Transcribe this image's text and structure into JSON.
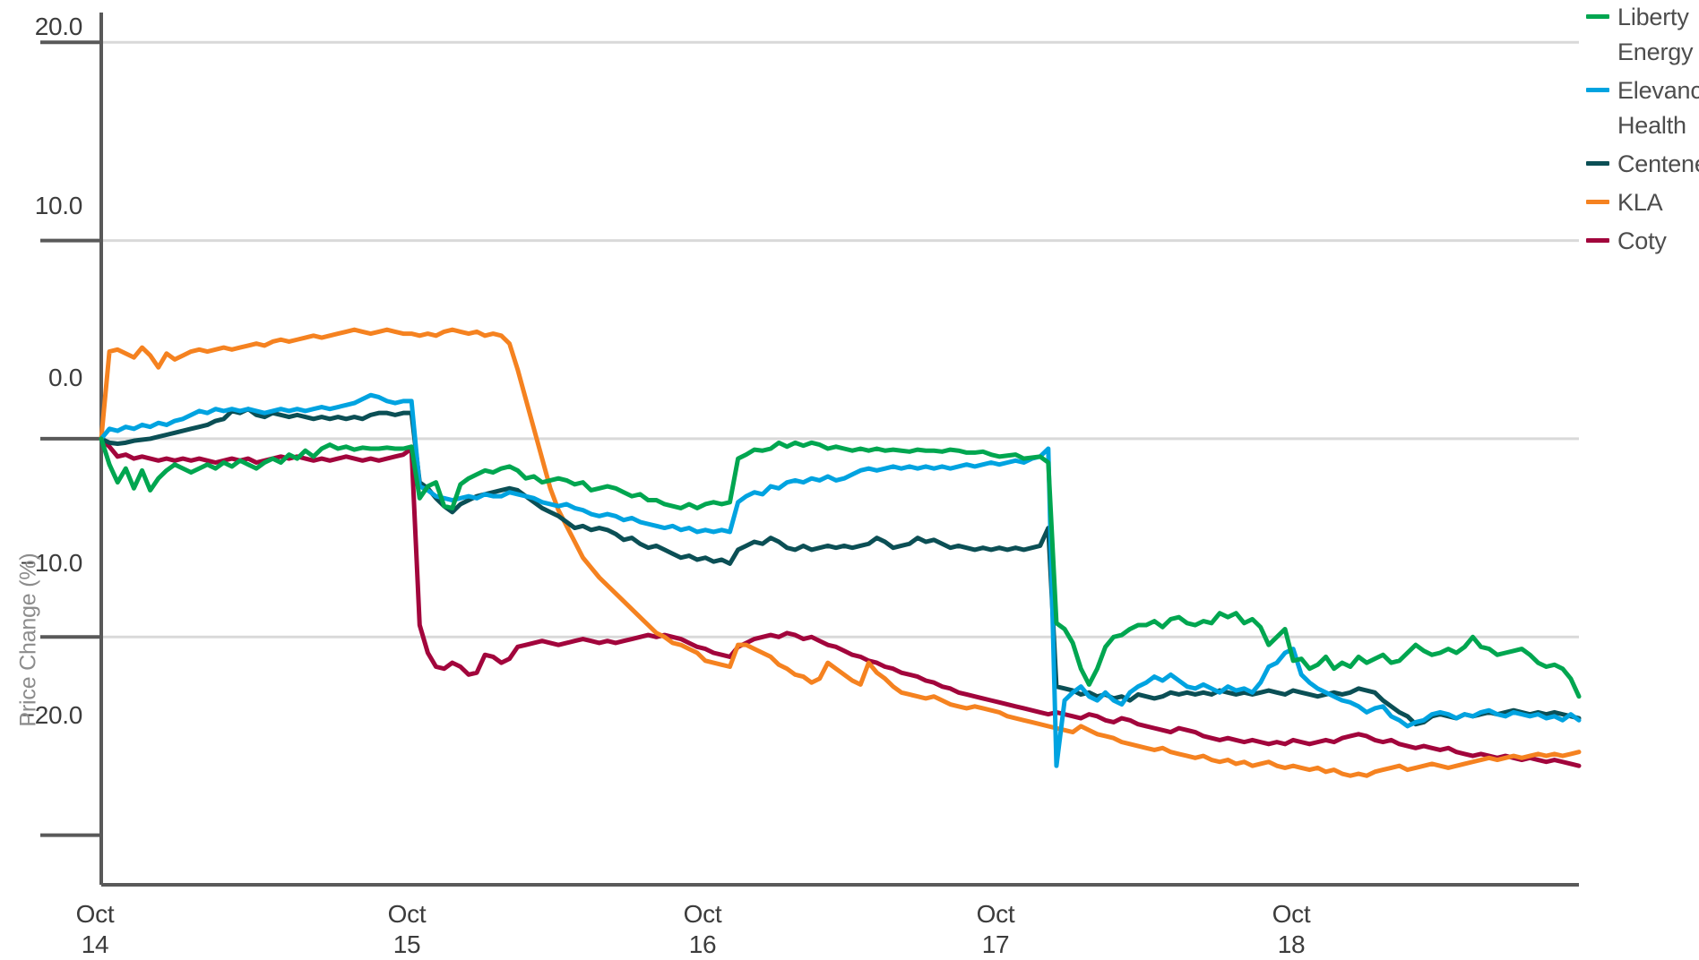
{
  "axes": {
    "ylabel": "Price Change (%)",
    "xlabel": "",
    "y_ticks": [
      "20.0",
      "10.0",
      "0.0",
      "−10.0",
      "−20.0"
    ],
    "x_ticks": [
      {
        "month": "Oct",
        "day": "14"
      },
      {
        "month": "Oct",
        "day": "15"
      },
      {
        "month": "Oct",
        "day": "16"
      },
      {
        "month": "Oct",
        "day": "17"
      },
      {
        "month": "Oct",
        "day": "18"
      }
    ]
  },
  "legend": {
    "position": "right",
    "items": [
      {
        "label": "Liberty Energy",
        "color": "#00A650"
      },
      {
        "label": "Elevance Health",
        "color": "#00A3E0"
      },
      {
        "label": "Centene",
        "color": "#0B4F55"
      },
      {
        "label": "KLA",
        "color": "#F58220"
      },
      {
        "label": "Coty",
        "color": "#A2053C"
      }
    ]
  },
  "chart_data": {
    "type": "line",
    "title": "",
    "subtitle": "",
    "xlabel": "",
    "ylabel": "Price Change (%)",
    "ylim": [
      -22.5,
      21.5
    ],
    "yticks": [
      20.0,
      10.0,
      0.0,
      -10.0,
      -20.0
    ],
    "grid": "horizontal",
    "legend_position": "right",
    "x_tick_labels": [
      "Oct 14",
      "Oct 15",
      "Oct 16",
      "Oct 17",
      "Oct 18"
    ],
    "x_tick_positions": [
      0,
      39,
      78,
      117,
      156
    ],
    "x_range": [
      0,
      180
    ],
    "x_unit": "intraday 15-minute bars across 5 trading sessions",
    "series": [
      {
        "name": "Liberty Energy",
        "color": "#00A650",
        "values": [
          0.0,
          -1.3,
          -2.2,
          -1.5,
          -2.5,
          -1.6,
          -2.6,
          -2.0,
          -1.6,
          -1.3,
          -1.5,
          -1.7,
          -1.5,
          -1.3,
          -1.5,
          -1.2,
          -1.4,
          -1.1,
          -1.3,
          -1.5,
          -1.2,
          -1.0,
          -1.2,
          -0.8,
          -1.0,
          -0.6,
          -0.9,
          -0.5,
          -0.3,
          -0.5,
          -0.4,
          -0.55,
          -0.45,
          -0.5,
          -0.5,
          -0.45,
          -0.5,
          -0.5,
          -0.4,
          -3.0,
          -2.4,
          -2.2,
          -3.4,
          -3.5,
          -2.3,
          -2.0,
          -1.8,
          -1.6,
          -1.7,
          -1.5,
          -1.4,
          -1.6,
          -2.0,
          -1.9,
          -2.2,
          -2.1,
          -2.0,
          -2.1,
          -2.3,
          -2.2,
          -2.6,
          -2.5,
          -2.4,
          -2.5,
          -2.7,
          -2.9,
          -2.8,
          -3.1,
          -3.1,
          -3.3,
          -3.4,
          -3.5,
          -3.3,
          -3.5,
          -3.3,
          -3.2,
          -3.3,
          -3.2,
          -1.0,
          -0.8,
          -0.55,
          -0.6,
          -0.5,
          -0.2,
          -0.4,
          -0.2,
          -0.35,
          -0.2,
          -0.3,
          -0.5,
          -0.4,
          -0.5,
          -0.6,
          -0.5,
          -0.6,
          -0.5,
          -0.6,
          -0.55,
          -0.6,
          -0.65,
          -0.55,
          -0.6,
          -0.6,
          -0.65,
          -0.55,
          -0.6,
          -0.7,
          -0.7,
          -0.65,
          -0.8,
          -0.9,
          -0.85,
          -0.8,
          -1.0,
          -0.95,
          -0.9,
          -1.2,
          -9.3,
          -9.6,
          -10.3,
          -11.6,
          -12.4,
          -11.6,
          -10.5,
          -10.0,
          -9.9,
          -9.6,
          -9.4,
          -9.4,
          -9.2,
          -9.5,
          -9.1,
          -9.0,
          -9.3,
          -9.4,
          -9.2,
          -9.3,
          -8.8,
          -9.0,
          -8.8,
          -9.3,
          -9.1,
          -9.5,
          -10.4,
          -10.0,
          -9.6,
          -11.2,
          -11.1,
          -11.6,
          -11.4,
          -11.0,
          -11.6,
          -11.3,
          -11.5,
          -11.0,
          -11.3,
          -11.1,
          -10.9,
          -11.3,
          -11.2,
          -10.8,
          -10.4,
          -10.7,
          -10.9,
          -10.8,
          -10.6,
          -10.8,
          -10.5,
          -10.0,
          -10.5,
          -10.6,
          -10.9,
          -10.8,
          -10.7,
          -10.6,
          -10.9,
          -11.3,
          -11.5,
          -11.4,
          -11.6,
          -12.1,
          -13.0
        ]
      },
      {
        "name": "Elevance Health",
        "color": "#00A3E0",
        "values": [
          0.0,
          0.5,
          0.4,
          0.6,
          0.5,
          0.7,
          0.6,
          0.8,
          0.7,
          0.9,
          1.0,
          1.2,
          1.4,
          1.3,
          1.5,
          1.4,
          1.5,
          1.4,
          1.5,
          1.4,
          1.3,
          1.4,
          1.5,
          1.4,
          1.5,
          1.4,
          1.5,
          1.6,
          1.5,
          1.6,
          1.7,
          1.8,
          2.0,
          2.2,
          2.1,
          1.9,
          1.8,
          1.9,
          1.9,
          -2.4,
          -2.6,
          -2.9,
          -3.0,
          -3.1,
          -3.0,
          -2.9,
          -3.0,
          -2.8,
          -2.9,
          -2.9,
          -2.7,
          -2.8,
          -2.9,
          -3.0,
          -3.2,
          -3.3,
          -3.4,
          -3.3,
          -3.5,
          -3.6,
          -3.8,
          -3.9,
          -3.8,
          -3.9,
          -4.1,
          -4.0,
          -4.2,
          -4.3,
          -4.4,
          -4.5,
          -4.4,
          -4.6,
          -4.5,
          -4.7,
          -4.6,
          -4.7,
          -4.6,
          -4.7,
          -3.2,
          -2.9,
          -2.7,
          -2.8,
          -2.4,
          -2.5,
          -2.2,
          -2.1,
          -2.2,
          -2.0,
          -2.1,
          -1.9,
          -2.1,
          -2.0,
          -1.8,
          -1.6,
          -1.5,
          -1.6,
          -1.5,
          -1.4,
          -1.5,
          -1.4,
          -1.5,
          -1.4,
          -1.5,
          -1.4,
          -1.5,
          -1.4,
          -1.3,
          -1.4,
          -1.3,
          -1.2,
          -1.3,
          -1.2,
          -1.1,
          -1.2,
          -1.0,
          -0.9,
          -0.5,
          -16.5,
          -13.2,
          -12.8,
          -12.5,
          -13.0,
          -13.2,
          -12.8,
          -13.2,
          -13.4,
          -12.8,
          -12.5,
          -12.3,
          -12.0,
          -12.2,
          -11.9,
          -12.2,
          -12.5,
          -12.6,
          -12.4,
          -12.6,
          -12.8,
          -12.5,
          -12.7,
          -12.6,
          -12.8,
          -12.3,
          -11.5,
          -11.3,
          -10.8,
          -10.6,
          -11.9,
          -12.3,
          -12.6,
          -12.8,
          -13.0,
          -13.2,
          -13.3,
          -13.5,
          -13.8,
          -13.6,
          -13.5,
          -14.0,
          -14.2,
          -14.5,
          -14.3,
          -14.2,
          -13.9,
          -13.8,
          -13.9,
          -14.1,
          -13.9,
          -14.0,
          -13.8,
          -13.7,
          -13.9,
          -14.0,
          -13.8,
          -13.9,
          -14.0,
          -13.9,
          -14.1,
          -14.0,
          -14.2,
          -13.9,
          -14.2
        ]
      },
      {
        "name": "Centene",
        "color": "#0B4F55",
        "values": [
          0.0,
          -0.2,
          -0.25,
          -0.2,
          -0.1,
          -0.05,
          0.0,
          0.1,
          0.2,
          0.3,
          0.4,
          0.5,
          0.6,
          0.7,
          0.9,
          1.0,
          1.4,
          1.3,
          1.5,
          1.2,
          1.1,
          1.3,
          1.2,
          1.1,
          1.2,
          1.1,
          1.0,
          1.1,
          1.0,
          1.1,
          1.0,
          1.1,
          1.0,
          1.2,
          1.3,
          1.3,
          1.2,
          1.3,
          1.3,
          -2.2,
          -2.5,
          -3.0,
          -3.4,
          -3.7,
          -3.3,
          -3.1,
          -2.9,
          -2.8,
          -2.7,
          -2.6,
          -2.5,
          -2.6,
          -2.9,
          -3.2,
          -3.5,
          -3.7,
          -3.9,
          -4.2,
          -4.5,
          -4.4,
          -4.6,
          -4.5,
          -4.6,
          -4.8,
          -5.1,
          -5.0,
          -5.3,
          -5.5,
          -5.4,
          -5.6,
          -5.8,
          -6.0,
          -5.9,
          -6.1,
          -6.0,
          -6.2,
          -6.1,
          -6.3,
          -5.6,
          -5.4,
          -5.2,
          -5.3,
          -5.0,
          -5.2,
          -5.5,
          -5.6,
          -5.4,
          -5.6,
          -5.5,
          -5.4,
          -5.5,
          -5.4,
          -5.5,
          -5.4,
          -5.3,
          -5.0,
          -5.2,
          -5.5,
          -5.4,
          -5.3,
          -5.0,
          -5.2,
          -5.1,
          -5.3,
          -5.5,
          -5.4,
          -5.5,
          -5.6,
          -5.5,
          -5.6,
          -5.5,
          -5.6,
          -5.5,
          -5.6,
          -5.5,
          -5.4,
          -4.5,
          -12.5,
          -12.6,
          -12.7,
          -12.9,
          -12.8,
          -13.0,
          -12.9,
          -13.1,
          -13.0,
          -13.2,
          -12.9,
          -13.0,
          -13.1,
          -13.0,
          -12.8,
          -12.9,
          -12.8,
          -12.9,
          -12.8,
          -12.9,
          -12.7,
          -12.8,
          -12.9,
          -12.8,
          -12.9,
          -12.8,
          -12.7,
          -12.8,
          -12.9,
          -12.7,
          -12.8,
          -12.9,
          -13.0,
          -12.9,
          -12.8,
          -12.9,
          -12.8,
          -12.6,
          -12.7,
          -12.8,
          -13.2,
          -13.5,
          -13.8,
          -14.0,
          -14.4,
          -14.3,
          -14.0,
          -13.9,
          -14.0,
          -14.1,
          -13.9,
          -14.0,
          -13.9,
          -13.8,
          -13.9,
          -13.8,
          -13.7,
          -13.8,
          -13.9,
          -13.8,
          -13.9,
          -13.8,
          -13.9,
          -14.0,
          -14.1
        ]
      },
      {
        "name": "KLA",
        "color": "#F58220",
        "values": [
          0.0,
          4.4,
          4.5,
          4.3,
          4.1,
          4.6,
          4.2,
          3.6,
          4.3,
          4.0,
          4.2,
          4.4,
          4.5,
          4.4,
          4.5,
          4.6,
          4.5,
          4.6,
          4.7,
          4.8,
          4.7,
          4.9,
          5.0,
          4.9,
          5.0,
          5.1,
          5.2,
          5.1,
          5.2,
          5.3,
          5.4,
          5.5,
          5.4,
          5.3,
          5.4,
          5.5,
          5.4,
          5.3,
          5.3,
          5.2,
          5.3,
          5.2,
          5.4,
          5.5,
          5.4,
          5.3,
          5.4,
          5.2,
          5.3,
          5.2,
          4.8,
          3.5,
          2.0,
          0.5,
          -1.0,
          -2.5,
          -3.6,
          -4.4,
          -5.2,
          -6.0,
          -6.5,
          -7.0,
          -7.4,
          -7.8,
          -8.2,
          -8.6,
          -9.0,
          -9.4,
          -9.8,
          -10.0,
          -10.3,
          -10.4,
          -10.6,
          -10.8,
          -11.2,
          -11.3,
          -11.4,
          -11.5,
          -10.4,
          -10.4,
          -10.6,
          -10.8,
          -11.0,
          -11.4,
          -11.6,
          -11.9,
          -12.0,
          -12.3,
          -12.1,
          -11.3,
          -11.6,
          -11.9,
          -12.2,
          -12.4,
          -11.3,
          -11.8,
          -12.1,
          -12.5,
          -12.8,
          -12.9,
          -13.0,
          -13.1,
          -13.0,
          -13.2,
          -13.4,
          -13.5,
          -13.6,
          -13.5,
          -13.6,
          -13.7,
          -13.8,
          -14.0,
          -14.1,
          -14.2,
          -14.3,
          -14.4,
          -14.5,
          -14.6,
          -14.7,
          -14.8,
          -14.5,
          -14.7,
          -14.9,
          -15.0,
          -15.1,
          -15.3,
          -15.4,
          -15.5,
          -15.6,
          -15.7,
          -15.6,
          -15.8,
          -15.9,
          -16.0,
          -16.1,
          -16.0,
          -16.2,
          -16.3,
          -16.2,
          -16.4,
          -16.3,
          -16.5,
          -16.4,
          -16.3,
          -16.5,
          -16.6,
          -16.5,
          -16.6,
          -16.7,
          -16.6,
          -16.8,
          -16.7,
          -16.9,
          -17.0,
          -16.9,
          -17.0,
          -16.8,
          -16.7,
          -16.6,
          -16.5,
          -16.7,
          -16.6,
          -16.5,
          -16.4,
          -16.5,
          -16.6,
          -16.5,
          -16.4,
          -16.3,
          -16.2,
          -16.1,
          -16.2,
          -16.1,
          -16.0,
          -16.1,
          -16.0,
          -15.9,
          -16.0,
          -15.9,
          -16.0,
          -15.9,
          -15.8
        ]
      },
      {
        "name": "Coty",
        "color": "#A2053C",
        "values": [
          0.0,
          -0.4,
          -0.9,
          -0.8,
          -1.0,
          -0.9,
          -1.0,
          -1.1,
          -1.0,
          -1.1,
          -1.0,
          -1.1,
          -1.0,
          -1.1,
          -1.2,
          -1.1,
          -1.0,
          -1.1,
          -1.0,
          -1.2,
          -1.1,
          -1.0,
          -0.9,
          -1.0,
          -0.9,
          -1.0,
          -1.1,
          -1.0,
          -1.1,
          -1.0,
          -0.9,
          -1.0,
          -1.1,
          -1.0,
          -1.1,
          -1.0,
          -0.9,
          -0.8,
          -0.5,
          -9.4,
          -10.8,
          -11.5,
          -11.6,
          -11.3,
          -11.5,
          -11.9,
          -11.8,
          -10.9,
          -11.0,
          -11.3,
          -11.1,
          -10.5,
          -10.4,
          -10.3,
          -10.2,
          -10.3,
          -10.4,
          -10.3,
          -10.2,
          -10.1,
          -10.2,
          -10.3,
          -10.2,
          -10.3,
          -10.2,
          -10.1,
          -10.0,
          -9.9,
          -10.0,
          -9.9,
          -10.0,
          -10.1,
          -10.3,
          -10.5,
          -10.6,
          -10.8,
          -10.9,
          -11.0,
          -10.5,
          -10.3,
          -10.1,
          -10.0,
          -9.9,
          -10.0,
          -9.8,
          -9.9,
          -10.1,
          -10.0,
          -10.2,
          -10.4,
          -10.5,
          -10.7,
          -10.9,
          -11.0,
          -11.2,
          -11.3,
          -11.5,
          -11.6,
          -11.8,
          -11.9,
          -12.0,
          -12.2,
          -12.3,
          -12.5,
          -12.6,
          -12.8,
          -12.9,
          -13.0,
          -13.1,
          -13.2,
          -13.3,
          -13.4,
          -13.5,
          -13.6,
          -13.7,
          -13.8,
          -13.9,
          -13.8,
          -13.9,
          -14.0,
          -14.1,
          -13.9,
          -14.0,
          -14.2,
          -14.3,
          -14.1,
          -14.2,
          -14.4,
          -14.5,
          -14.6,
          -14.7,
          -14.8,
          -14.6,
          -14.7,
          -14.8,
          -15.0,
          -15.1,
          -15.2,
          -15.1,
          -15.2,
          -15.3,
          -15.2,
          -15.3,
          -15.4,
          -15.3,
          -15.4,
          -15.2,
          -15.3,
          -15.4,
          -15.3,
          -15.2,
          -15.3,
          -15.1,
          -15.0,
          -14.9,
          -15.0,
          -15.2,
          -15.3,
          -15.2,
          -15.4,
          -15.5,
          -15.6,
          -15.5,
          -15.6,
          -15.7,
          -15.6,
          -15.8,
          -15.9,
          -16.0,
          -15.9,
          -16.0,
          -16.1,
          -16.0,
          -16.1,
          -16.2,
          -16.1,
          -16.2,
          -16.3,
          -16.2,
          -16.3,
          -16.4,
          -16.5
        ]
      }
    ]
  },
  "style": {
    "grid_color": "#d9d9d9",
    "axis_color": "#595959",
    "tick_text_color": "#3c3c3c",
    "legend_text_color": "#4d4d4d",
    "background": "#ffffff"
  }
}
